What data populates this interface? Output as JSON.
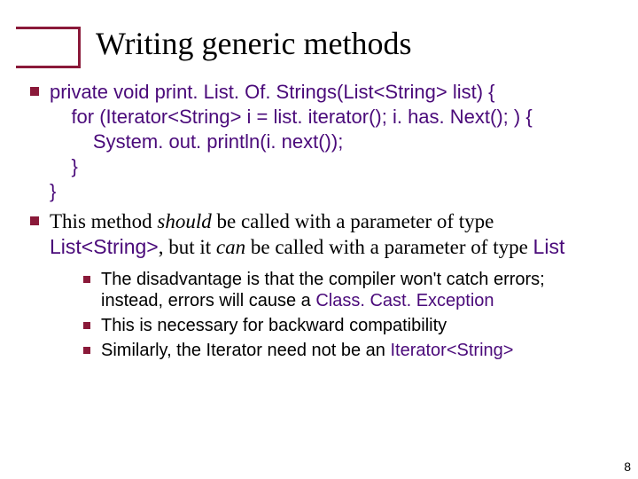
{
  "title": "Writing generic methods",
  "code": {
    "line1": "private void print. List. Of. Strings(List<String> list) {",
    "line2": "    for (Iterator<String> i = list. iterator(); i. has. Next(); ) {",
    "line3": "        System. out. println(i. next());",
    "line4": "    }",
    "line5": "}"
  },
  "para2": {
    "t1": "This method ",
    "should": "should",
    "t2": " be called with a parameter of type ",
    "code1": "List<String>",
    "t3": ", but it ",
    "can": "can",
    "t4": " be called with a parameter of type ",
    "code2": "List"
  },
  "sub": {
    "s1a": "The disadvantage is that the compiler won't catch errors; instead, errors will cause a ",
    "s1code": "Class. Cast. Exception",
    "s2": "This is necessary for backward compatibility",
    "s3a": "Similarly, the Iterator need not be an ",
    "s3code": "Iterator<String>"
  },
  "page": "8"
}
